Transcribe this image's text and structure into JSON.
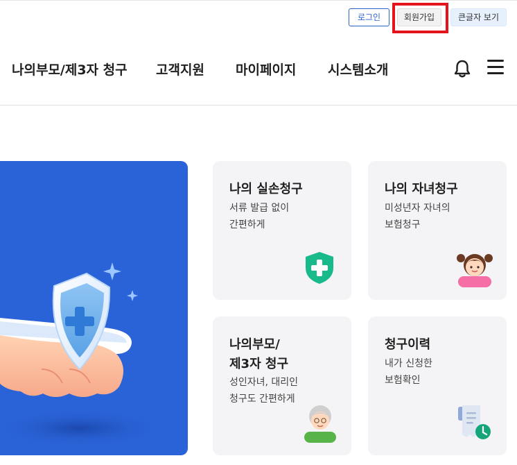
{
  "utility": {
    "login": "로그인",
    "signup": "회원가입",
    "big_text": "큰글자 보기"
  },
  "nav": {
    "items": [
      "나의부모/제3자 청구",
      "고객지원",
      "마이페이지",
      "시스템소개"
    ]
  },
  "icons": {
    "bell": "bell-icon",
    "menu": "hamburger-menu-icon"
  },
  "cards": [
    {
      "title": "나의 실손청구",
      "desc": "서류 발급 없이\n간편하게",
      "icon": "shield-plus-icon"
    },
    {
      "title": "나의 자녀청구",
      "desc": "미성년자 자녀의\n보험청구",
      "icon": "child-avatar-icon"
    },
    {
      "title": "나의부모/\n제3자 청구",
      "desc": "성인자녀, 대리인\n청구도 간편하게",
      "icon": "grandparent-avatar-icon"
    },
    {
      "title": "청구이력",
      "desc": "내가 신청한\n보험확인",
      "icon": "receipt-clock-icon"
    }
  ],
  "colors": {
    "accent": "#2b63c9",
    "hero_bg": "#2a63d8",
    "highlight": "#e3141b",
    "card_bg": "#f4f4f6"
  }
}
